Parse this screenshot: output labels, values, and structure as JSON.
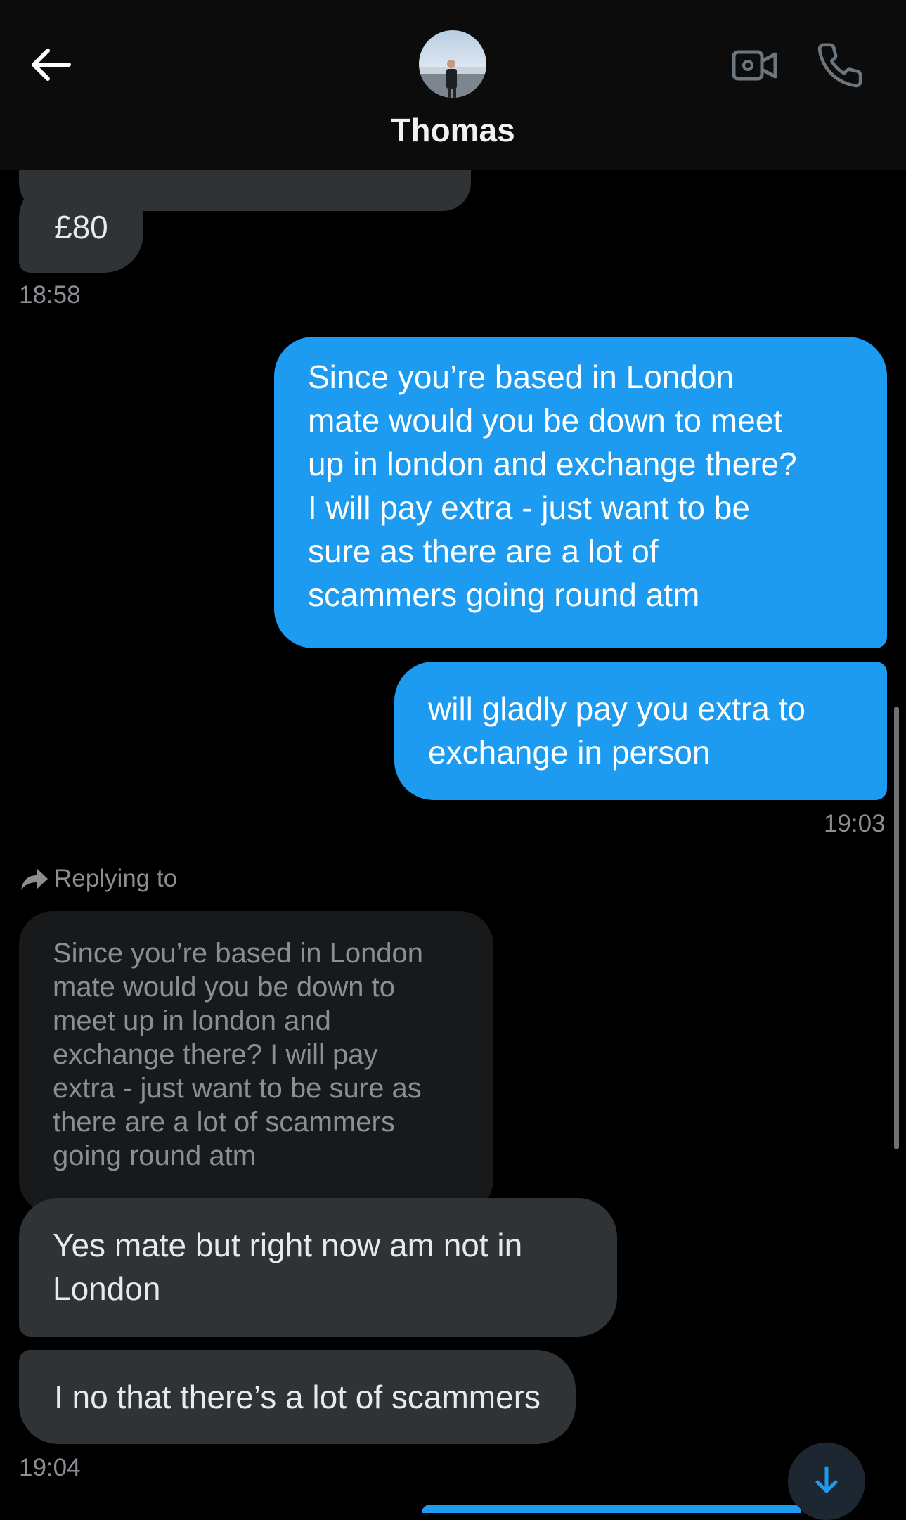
{
  "header": {
    "contact_name": "Thomas",
    "back_icon": "back-arrow-icon",
    "video_icon": "video-call-icon",
    "phone_icon": "phone-call-icon"
  },
  "messages": [
    {
      "side": "in",
      "text": "£80"
    },
    {
      "time": "18:58"
    },
    {
      "side": "out",
      "text_lines": [
        "Since you’re based in London",
        "mate would you be down to meet",
        "up in london and exchange there?",
        "I will pay extra - just want to be",
        "sure as there are a lot of",
        "scammers going round atm"
      ]
    },
    {
      "side": "out",
      "text_lines": [
        "will gladly pay you extra to",
        "exchange in person"
      ]
    },
    {
      "time": "19:03"
    },
    {
      "reply_label": "Replying to",
      "reply_icon": "reply-arrow-icon"
    },
    {
      "quoted_lines": [
        "Since you’re based in London",
        "mate would you be down to",
        "meet up in london and",
        "exchange there? I will pay",
        "extra - just want to be sure as",
        "there are a lot of scammers",
        "going round atm"
      ]
    },
    {
      "side": "in",
      "text_lines": [
        "Yes mate but right now am not in",
        "London"
      ]
    },
    {
      "side": "in",
      "text": "I no that there’s a lot of scammers"
    },
    {
      "time": "19:04"
    }
  ],
  "colors": {
    "accent": "#1d9bf0",
    "incoming_bubble": "#2f3336",
    "background": "#000000"
  }
}
